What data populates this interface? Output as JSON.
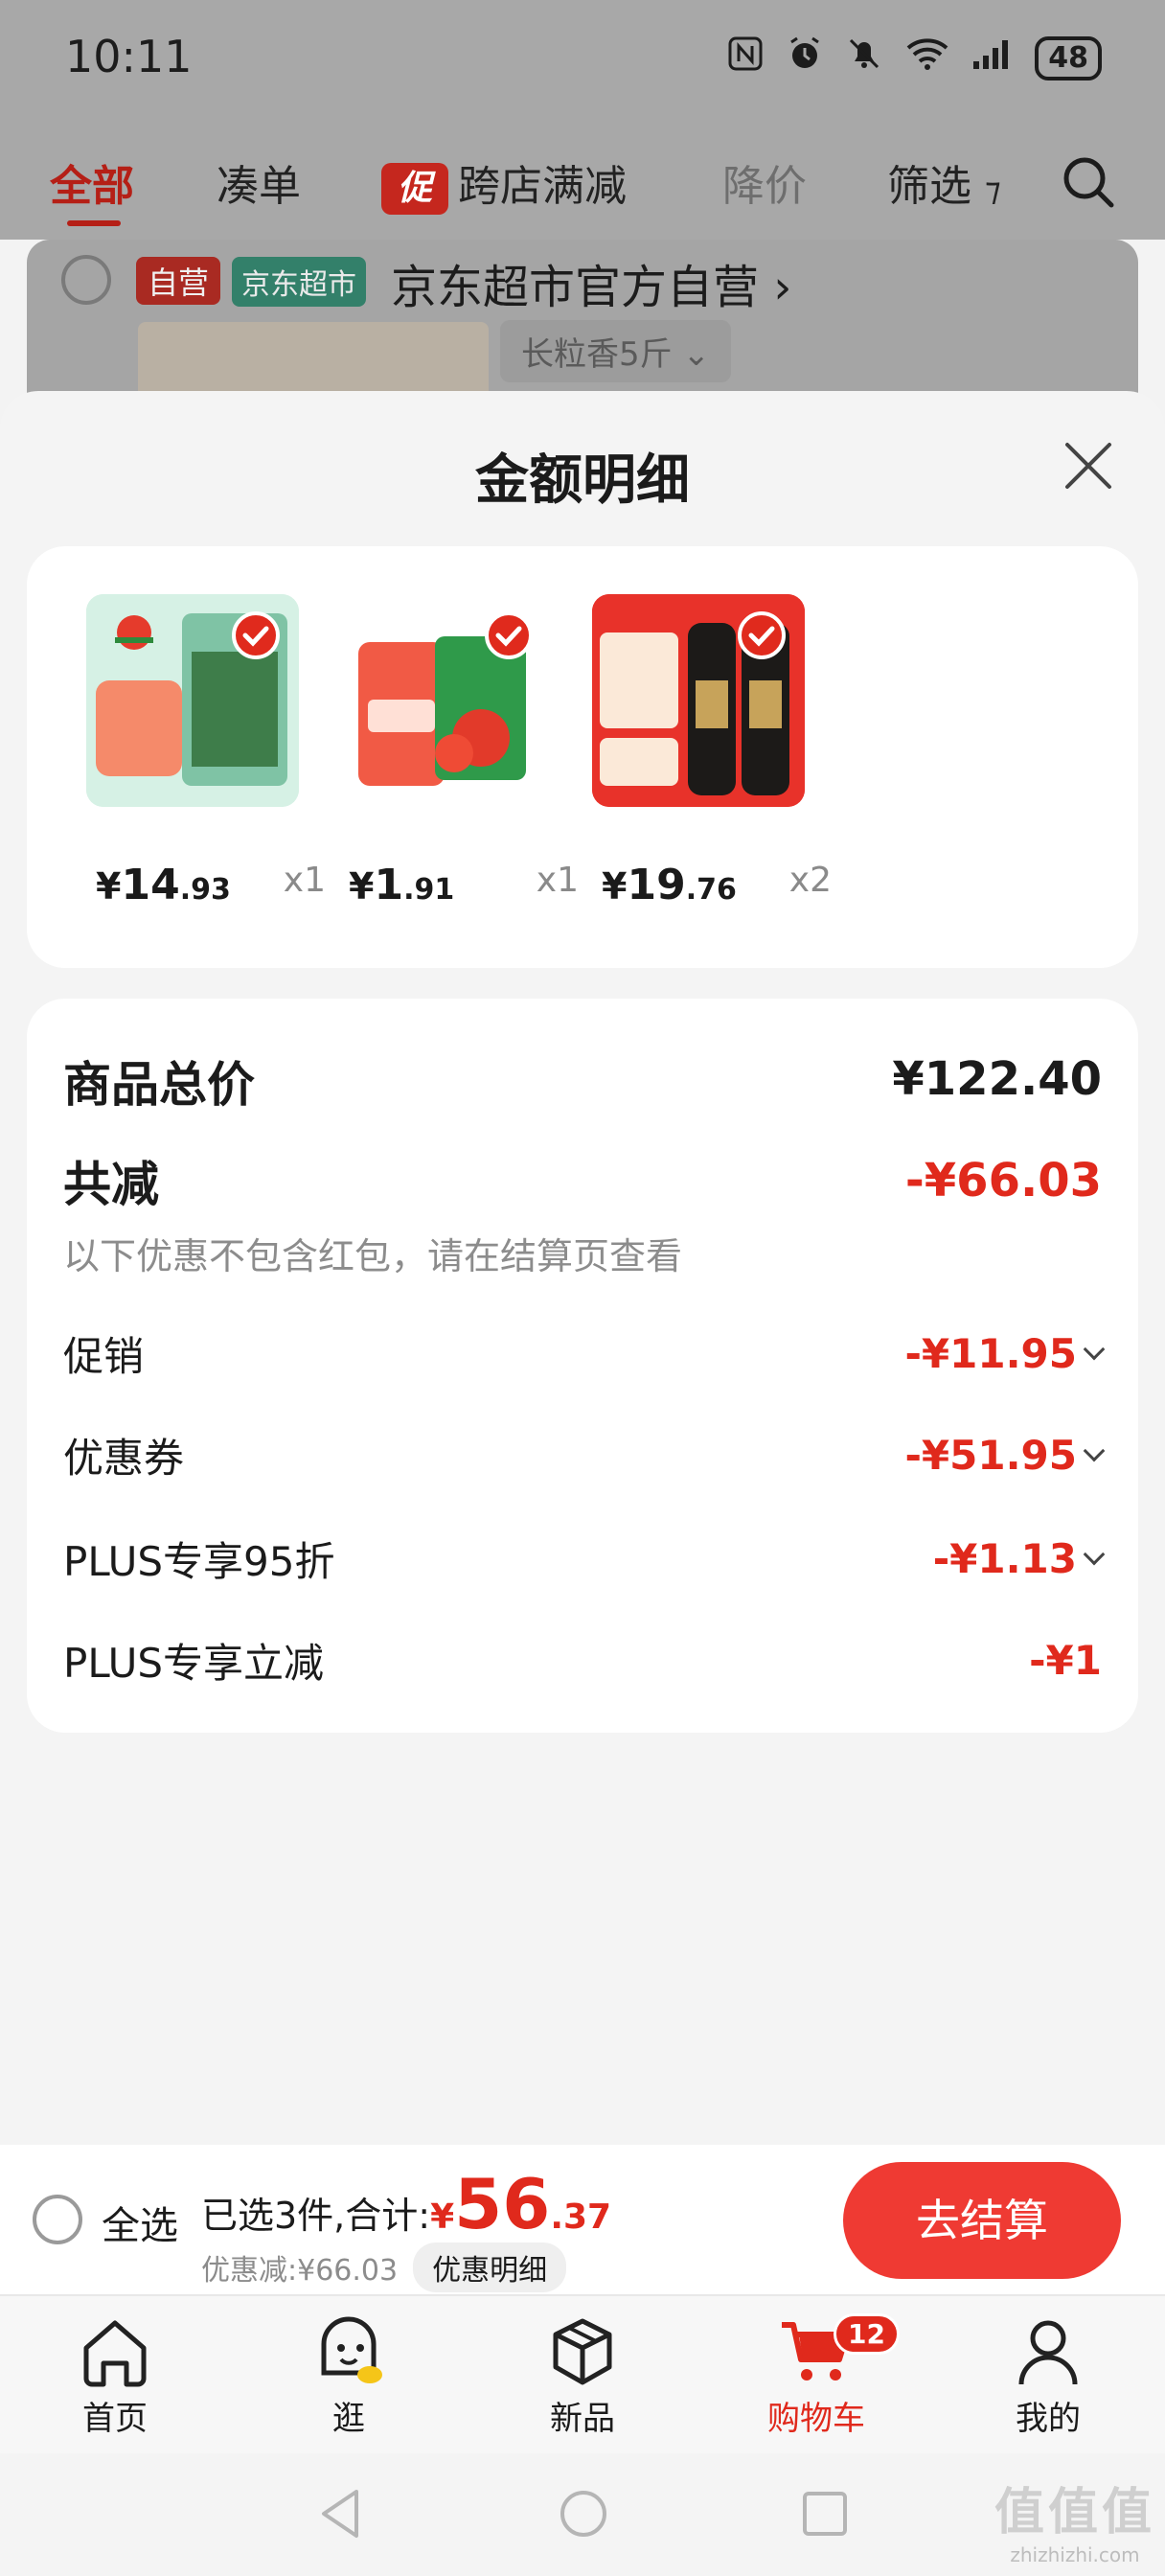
{
  "status_bar": {
    "time": "10:11",
    "battery": "48"
  },
  "filter_bar": {
    "all": "全部",
    "bundle": "凑单",
    "promo_badge": "促",
    "cross_store": "跨店满减",
    "price_drop": "降价",
    "filter": "筛选"
  },
  "store_row": {
    "tag_self": "自营",
    "tag_jd": "京东超市",
    "name": "京东超市官方自营 ›",
    "spec": "长粒香5斤 ⌄"
  },
  "sheet": {
    "title": "金额明细",
    "products": [
      {
        "price_symbol": "¥",
        "price_int": "14",
        "price_dec": ".93",
        "qty": "x1",
        "img_color": "#cfeee0",
        "icon": "rice-bag-image"
      },
      {
        "price_symbol": "¥",
        "price_int": "1",
        "price_dec": ".91",
        "qty": "x1",
        "img_color": "#ffffff",
        "icon": "tomato-sauce-image"
      },
      {
        "price_symbol": "¥",
        "price_int": "19",
        "price_dec": ".76",
        "qty": "x2",
        "img_color": "#e8322a",
        "icon": "soy-sauce-image"
      }
    ],
    "summary": {
      "total_label": "商品总价",
      "total_value": "¥122.40",
      "reduce_label": "共减",
      "reduce_value": "-¥66.03",
      "note": "以下优惠不包含红包，请在结算页查看",
      "rows": [
        {
          "label": "促销",
          "value": "-¥11.95"
        },
        {
          "label": "优惠券",
          "value": "-¥51.95"
        },
        {
          "label": "PLUS专享95折",
          "value": "-¥1.13"
        },
        {
          "label": "PLUS专享立减",
          "value": "-¥1"
        }
      ]
    }
  },
  "checkout": {
    "select_all": "全选",
    "selected_text": "已选3件,合计:",
    "total_symbol": "¥",
    "total_int": "56",
    "total_dec": ".37",
    "discount_text": "优惠减:¥66.03",
    "detail_chip": "优惠明细",
    "checkout_button": "去结算"
  },
  "tabs": [
    {
      "label": "首页",
      "icon": "home-icon"
    },
    {
      "label": "逛",
      "icon": "browse-icon"
    },
    {
      "label": "新品",
      "icon": "new-products-icon"
    },
    {
      "label": "购物车",
      "icon": "cart-icon",
      "badge": "12",
      "active": true
    },
    {
      "label": "我的",
      "icon": "profile-icon"
    }
  ],
  "watermark": {
    "big": "值值值",
    "small": "zhizhizhi.com"
  },
  "colors": {
    "accent_red": "#e0291c",
    "checkout_button": "#ef3a33",
    "active_tab": "#e0291c"
  }
}
